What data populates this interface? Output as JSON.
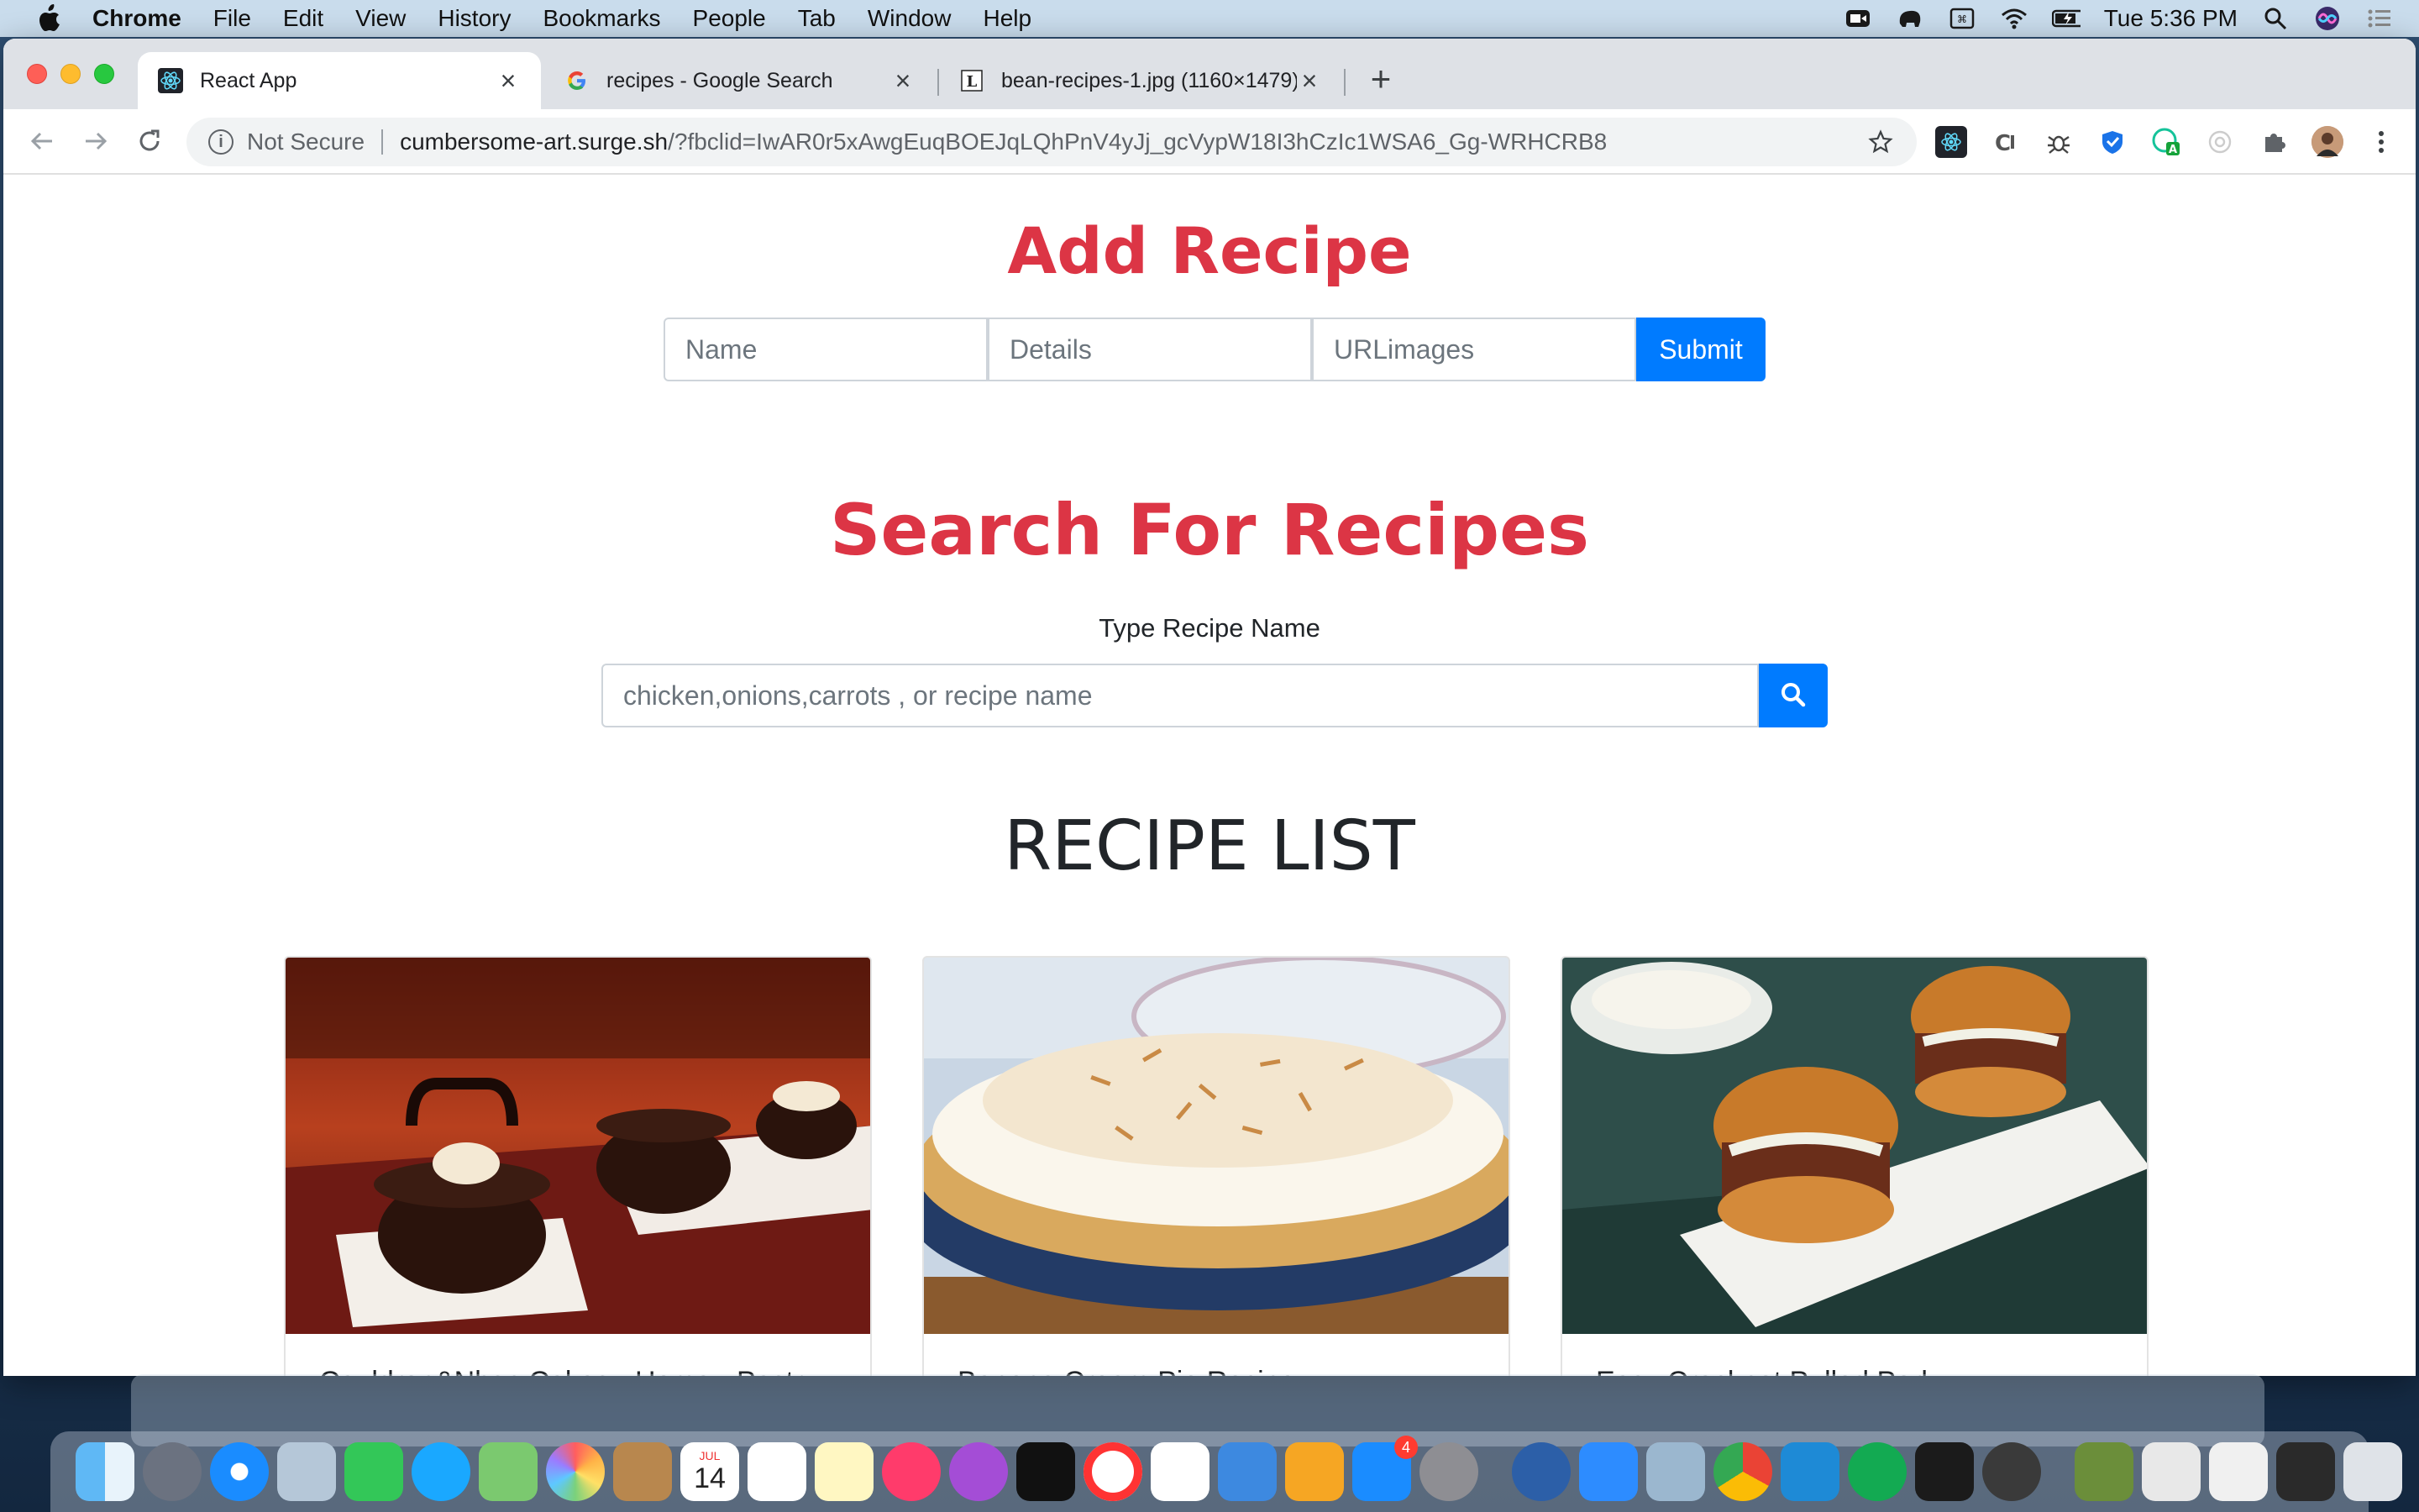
{
  "menubar": {
    "app_name": "Chrome",
    "items": [
      "File",
      "Edit",
      "View",
      "History",
      "Bookmarks",
      "People",
      "Tab",
      "Window",
      "Help"
    ],
    "clock": "Tue 5:36 PM"
  },
  "browser": {
    "tabs": [
      {
        "title": "React App",
        "icon": "react-icon"
      },
      {
        "title": "recipes - Google Search",
        "icon": "google-icon"
      },
      {
        "title": "bean-recipes-1.jpg (1160×1479)",
        "icon": "page-icon"
      }
    ],
    "security_label": "Not Secure",
    "url_host": "cumbersome-art.surge.sh",
    "url_path": "/?fbclid=IwAR0r5xAwgEuqBOEJqLQhPnV4yJj_gcVypW18I3hCzIc1WSA6_Gg-WRHCRB8"
  },
  "add_recipe": {
    "heading": "Add Recipe",
    "name_placeholder": "Name",
    "details_placeholder": "Details",
    "url_placeholder": "URLimages",
    "submit_label": "Submit"
  },
  "search": {
    "heading": "Search For Recipes",
    "label": "Type Recipe Name",
    "placeholder": "chicken,onions,carrots , or recipe name"
  },
  "recipe_list": {
    "heading": "RECIPE LIST",
    "cards": [
      {
        "title": "Cauldron&Nbsp;Cakes - Home - Pastry Affair"
      },
      {
        "title": "Banana Cream Pie Recipe"
      },
      {
        "title": "Easy Crockpot Pulled Pork"
      }
    ]
  },
  "dock": {
    "calendar_month": "JUL",
    "calendar_day": "14",
    "appstore_badge": "4"
  }
}
